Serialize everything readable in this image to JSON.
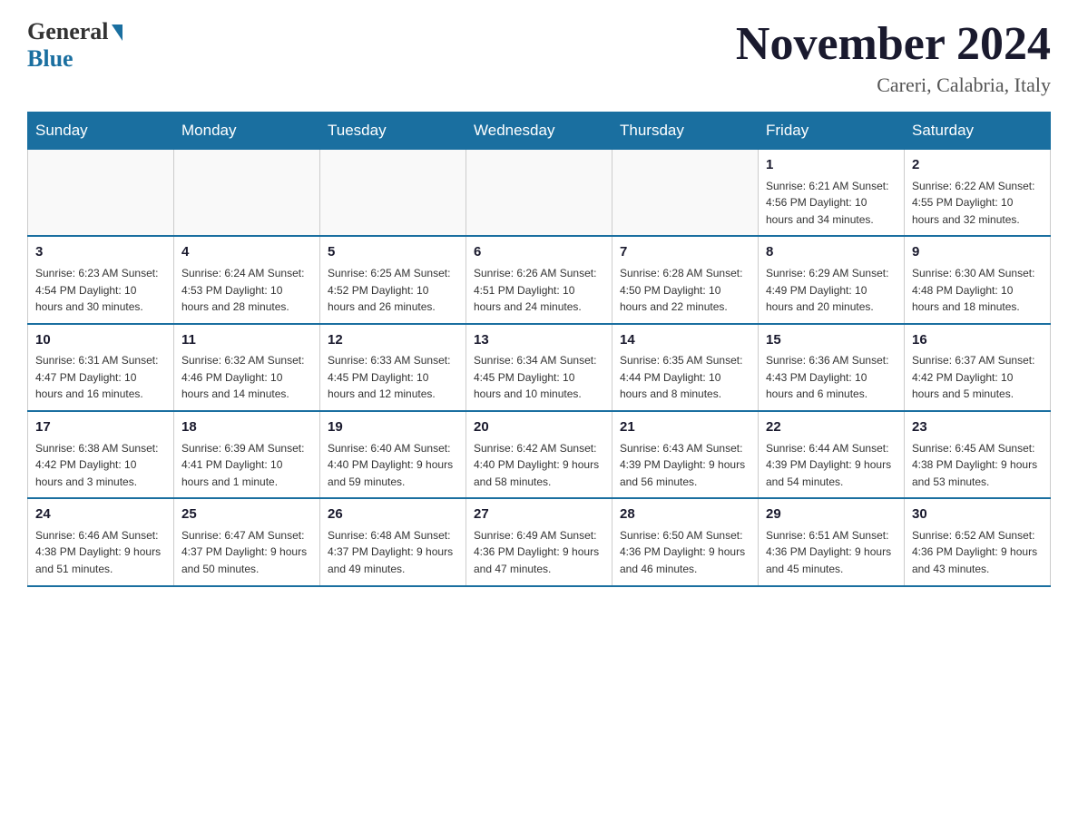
{
  "header": {
    "logo_general": "General",
    "logo_blue": "Blue",
    "month_title": "November 2024",
    "location": "Careri, Calabria, Italy"
  },
  "days_of_week": [
    "Sunday",
    "Monday",
    "Tuesday",
    "Wednesday",
    "Thursday",
    "Friday",
    "Saturday"
  ],
  "weeks": [
    [
      {
        "day": "",
        "info": ""
      },
      {
        "day": "",
        "info": ""
      },
      {
        "day": "",
        "info": ""
      },
      {
        "day": "",
        "info": ""
      },
      {
        "day": "",
        "info": ""
      },
      {
        "day": "1",
        "info": "Sunrise: 6:21 AM\nSunset: 4:56 PM\nDaylight: 10 hours and 34 minutes."
      },
      {
        "day": "2",
        "info": "Sunrise: 6:22 AM\nSunset: 4:55 PM\nDaylight: 10 hours and 32 minutes."
      }
    ],
    [
      {
        "day": "3",
        "info": "Sunrise: 6:23 AM\nSunset: 4:54 PM\nDaylight: 10 hours and 30 minutes."
      },
      {
        "day": "4",
        "info": "Sunrise: 6:24 AM\nSunset: 4:53 PM\nDaylight: 10 hours and 28 minutes."
      },
      {
        "day": "5",
        "info": "Sunrise: 6:25 AM\nSunset: 4:52 PM\nDaylight: 10 hours and 26 minutes."
      },
      {
        "day": "6",
        "info": "Sunrise: 6:26 AM\nSunset: 4:51 PM\nDaylight: 10 hours and 24 minutes."
      },
      {
        "day": "7",
        "info": "Sunrise: 6:28 AM\nSunset: 4:50 PM\nDaylight: 10 hours and 22 minutes."
      },
      {
        "day": "8",
        "info": "Sunrise: 6:29 AM\nSunset: 4:49 PM\nDaylight: 10 hours and 20 minutes."
      },
      {
        "day": "9",
        "info": "Sunrise: 6:30 AM\nSunset: 4:48 PM\nDaylight: 10 hours and 18 minutes."
      }
    ],
    [
      {
        "day": "10",
        "info": "Sunrise: 6:31 AM\nSunset: 4:47 PM\nDaylight: 10 hours and 16 minutes."
      },
      {
        "day": "11",
        "info": "Sunrise: 6:32 AM\nSunset: 4:46 PM\nDaylight: 10 hours and 14 minutes."
      },
      {
        "day": "12",
        "info": "Sunrise: 6:33 AM\nSunset: 4:45 PM\nDaylight: 10 hours and 12 minutes."
      },
      {
        "day": "13",
        "info": "Sunrise: 6:34 AM\nSunset: 4:45 PM\nDaylight: 10 hours and 10 minutes."
      },
      {
        "day": "14",
        "info": "Sunrise: 6:35 AM\nSunset: 4:44 PM\nDaylight: 10 hours and 8 minutes."
      },
      {
        "day": "15",
        "info": "Sunrise: 6:36 AM\nSunset: 4:43 PM\nDaylight: 10 hours and 6 minutes."
      },
      {
        "day": "16",
        "info": "Sunrise: 6:37 AM\nSunset: 4:42 PM\nDaylight: 10 hours and 5 minutes."
      }
    ],
    [
      {
        "day": "17",
        "info": "Sunrise: 6:38 AM\nSunset: 4:42 PM\nDaylight: 10 hours and 3 minutes."
      },
      {
        "day": "18",
        "info": "Sunrise: 6:39 AM\nSunset: 4:41 PM\nDaylight: 10 hours and 1 minute."
      },
      {
        "day": "19",
        "info": "Sunrise: 6:40 AM\nSunset: 4:40 PM\nDaylight: 9 hours and 59 minutes."
      },
      {
        "day": "20",
        "info": "Sunrise: 6:42 AM\nSunset: 4:40 PM\nDaylight: 9 hours and 58 minutes."
      },
      {
        "day": "21",
        "info": "Sunrise: 6:43 AM\nSunset: 4:39 PM\nDaylight: 9 hours and 56 minutes."
      },
      {
        "day": "22",
        "info": "Sunrise: 6:44 AM\nSunset: 4:39 PM\nDaylight: 9 hours and 54 minutes."
      },
      {
        "day": "23",
        "info": "Sunrise: 6:45 AM\nSunset: 4:38 PM\nDaylight: 9 hours and 53 minutes."
      }
    ],
    [
      {
        "day": "24",
        "info": "Sunrise: 6:46 AM\nSunset: 4:38 PM\nDaylight: 9 hours and 51 minutes."
      },
      {
        "day": "25",
        "info": "Sunrise: 6:47 AM\nSunset: 4:37 PM\nDaylight: 9 hours and 50 minutes."
      },
      {
        "day": "26",
        "info": "Sunrise: 6:48 AM\nSunset: 4:37 PM\nDaylight: 9 hours and 49 minutes."
      },
      {
        "day": "27",
        "info": "Sunrise: 6:49 AM\nSunset: 4:36 PM\nDaylight: 9 hours and 47 minutes."
      },
      {
        "day": "28",
        "info": "Sunrise: 6:50 AM\nSunset: 4:36 PM\nDaylight: 9 hours and 46 minutes."
      },
      {
        "day": "29",
        "info": "Sunrise: 6:51 AM\nSunset: 4:36 PM\nDaylight: 9 hours and 45 minutes."
      },
      {
        "day": "30",
        "info": "Sunrise: 6:52 AM\nSunset: 4:36 PM\nDaylight: 9 hours and 43 minutes."
      }
    ]
  ]
}
